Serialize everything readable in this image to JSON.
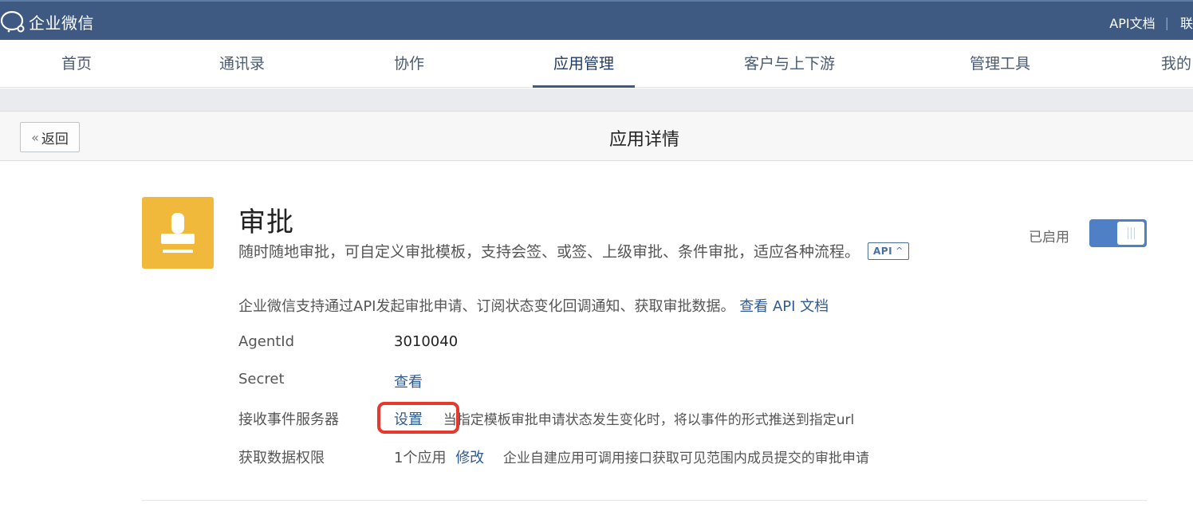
{
  "topbar": {
    "brand": "企业微信",
    "links": [
      "API文档",
      "联"
    ]
  },
  "nav": {
    "items": [
      {
        "label": "首页"
      },
      {
        "label": "通讯录"
      },
      {
        "label": "协作"
      },
      {
        "label": "应用管理",
        "active": true
      },
      {
        "label": "客户与上下游"
      },
      {
        "label": "管理工具"
      },
      {
        "label": "我的"
      }
    ]
  },
  "page": {
    "back_label": "返回",
    "title": "应用详情"
  },
  "app": {
    "name": "审批",
    "description": "随时随地审批，可自定义审批模板，支持会签、或签、上级审批、条件审批，适应各种流程。",
    "api_tag": "API",
    "status_label": "已启用",
    "enabled": true,
    "icon": "stamp-icon",
    "icon_color": "#f0b93b"
  },
  "api_info": {
    "text": "企业微信支持通过API发起审批申请、订阅状态变化回调通知、获取审批数据。",
    "link": "查看 API 文档"
  },
  "rows": {
    "agentid": {
      "label": "AgentId",
      "value": "3010040"
    },
    "secret": {
      "label": "Secret",
      "action": "查看"
    },
    "event_server": {
      "label": "接收事件服务器",
      "action": "设置",
      "hint": "当指定模板审批申请状态发生变化时，将以事件的形式推送到指定url"
    },
    "data_permission": {
      "label": "获取数据权限",
      "value": "1个应用",
      "action": "修改",
      "hint": "企业自建应用可调用接口获取可见范围内成员提交的审批申请"
    }
  },
  "colors": {
    "topbar": "#3e5a83",
    "accent": "#4f80c5",
    "link": "#2f5b94",
    "highlight": "#e4392b"
  }
}
